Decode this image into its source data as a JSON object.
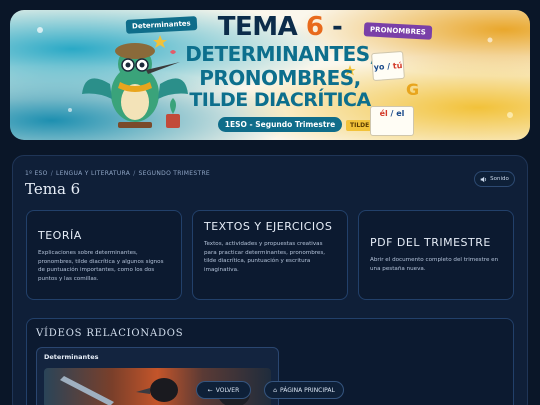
{
  "banner": {
    "tag_left": "Determinantes",
    "tag_right": "PRONOMBRES",
    "title_prefix": "TEMA",
    "title_number": "6",
    "title_dash": " -",
    "line2": "DETERMINANTES,",
    "line3": "PRONOMBRES,",
    "line4": "TILDE DIACRÍTICA",
    "subtitle": "1ESO - Segundo Trimestre",
    "tilde_tag": "TILDE",
    "card_yo": "yo / ",
    "card_tu": "tú",
    "card_g": "G",
    "card_el_acc": "él",
    "card_el": " / el"
  },
  "breadcrumb": [
    "1º ESO",
    "LENGUA Y LITERATURA",
    "SEGUNDO TRIMESTRE"
  ],
  "breadcrumb_sep": "/",
  "page_title": "Tema 6",
  "sound_button": {
    "label": "Sonido",
    "icon": "speaker-icon"
  },
  "cards": [
    {
      "title": "TEORÍA",
      "description": "Explicaciones sobre determinantes, pronombres, tilde diacrítica y algunos signos de puntuación importantes, como los dos puntos y las comillas."
    },
    {
      "title": "TEXTOS Y EJERCICIOS",
      "description": "Textos, actividades y propuestas creativas para practicar determinantes, pronombres, tilde diacrítica, puntuación y escritura imaginativa."
    },
    {
      "title": "PDF DEL TRIMESTRE",
      "description": "Abrir el documento completo del trimestre en una pestaña nueva."
    }
  ],
  "videos": {
    "section_title": "VÍDEOS RELACIONADOS",
    "items": [
      {
        "label": "Determinantes"
      }
    ]
  },
  "nav": {
    "back_icon": "←",
    "back_label": "VOLVER",
    "home_icon": "⌂",
    "home_label": "PÁGINA PRINCIPAL"
  },
  "colors": {
    "background": "#0a1628",
    "panel": "#0f1f38",
    "card_border": "#22406a",
    "accent_teal": "#0f6d8a",
    "accent_orange": "#e86a1c"
  }
}
